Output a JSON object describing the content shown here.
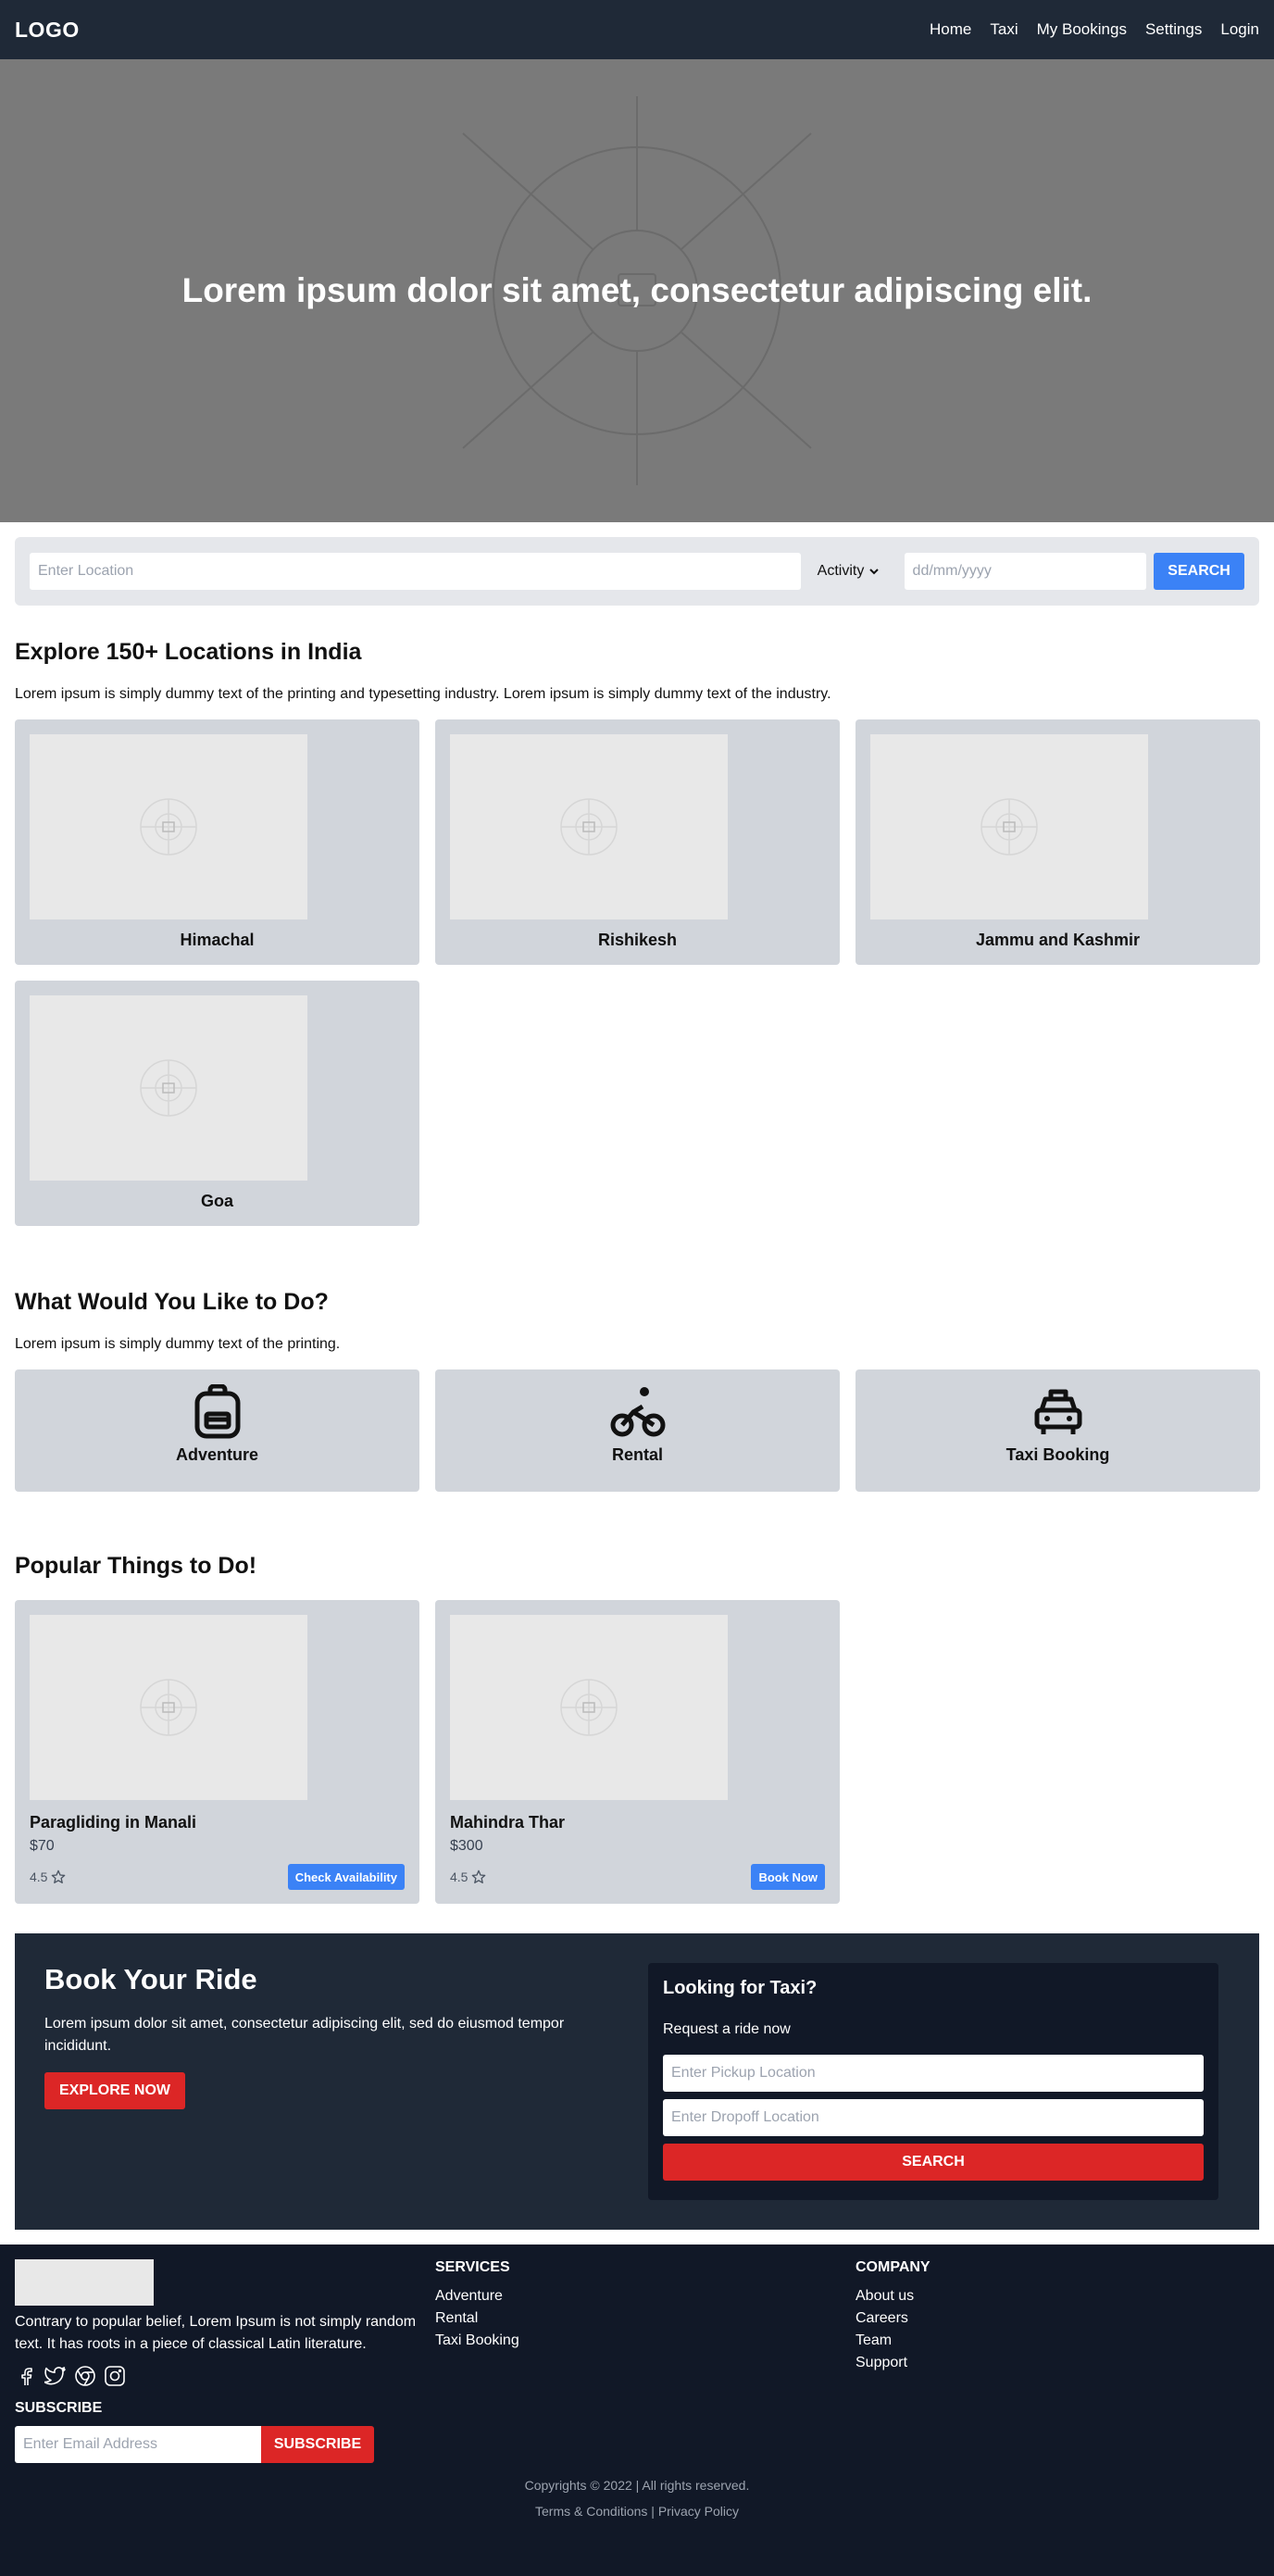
{
  "nav": {
    "logo": "LOGO",
    "links": [
      "Home",
      "Taxi",
      "My Bookings",
      "Settings",
      "Login"
    ]
  },
  "hero": {
    "title": "Lorem ipsum dolor sit amet, consectetur adipiscing elit."
  },
  "search": {
    "location_placeholder": "Enter Location",
    "activity_value": "Activity",
    "date_placeholder": "dd/mm/yyyy",
    "button": "SEARCH"
  },
  "explore": {
    "title": "Explore 150+ Locations in India",
    "desc": "Lorem ipsum is simply dummy text of the printing and typesetting industry. Lorem ipsum is simply dummy text of the industry.",
    "locations": [
      "Himachal",
      "Rishikesh",
      "Jammu and Kashmir",
      "Goa"
    ]
  },
  "activities": {
    "title": "What Would You Like to Do?",
    "desc": "Lorem ipsum is simply dummy text of the printing.",
    "items": [
      {
        "label": "Adventure",
        "icon": "backpack-icon"
      },
      {
        "label": "Rental",
        "icon": "bicycle-icon"
      },
      {
        "label": "Taxi Booking",
        "icon": "taxi-icon"
      }
    ]
  },
  "popular": {
    "title": "Popular Things to Do!",
    "items": [
      {
        "title": "Paragliding in Manali",
        "price": "$70",
        "rating": "4.5",
        "button": "Check Availability"
      },
      {
        "title": "Mahindra Thar",
        "price": "$300",
        "rating": "4.5",
        "button": "Book Now"
      }
    ]
  },
  "book": {
    "title": "Book Your Ride",
    "desc": "Lorem ipsum dolor sit amet, consectetur adipiscing elit, sed do eiusmod tempor incididunt.",
    "explore_btn": "EXPLORE NOW",
    "taxi_title": "Looking for Taxi?",
    "taxi_sub": "Request a ride now",
    "pickup_placeholder": "Enter Pickup Location",
    "dropoff_placeholder": "Enter Dropoff Location",
    "search_btn": "SEARCH"
  },
  "footer": {
    "desc": "Contrary to popular belief, Lorem Ipsum is not simply random text. It has roots in a piece of classical Latin literature.",
    "services_title": "SERVICES",
    "services": [
      "Adventure",
      "Rental",
      "Taxi Booking"
    ],
    "company_title": "COMPANY",
    "company": [
      "About us",
      "Careers",
      "Team",
      "Support"
    ],
    "social_icons": [
      "facebook-icon",
      "twitter-icon",
      "chrome-icon",
      "instagram-icon"
    ],
    "subscribe_title": "SUBSCRIBE",
    "email_placeholder": "Enter Email Address",
    "subscribe_btn": "SUBSCRIBE",
    "copyright": "Copyrights © 2022 | All rights reserved.",
    "terms": "Terms & Conditions",
    "privacy": "Privacy Policy",
    "sep": "|"
  },
  "colors": {
    "nav_bg": "#1f2937",
    "accent_blue": "#3b82f6",
    "accent_red": "#dc2626",
    "footer_bg": "#111827",
    "card_bg": "#d1d5db"
  }
}
